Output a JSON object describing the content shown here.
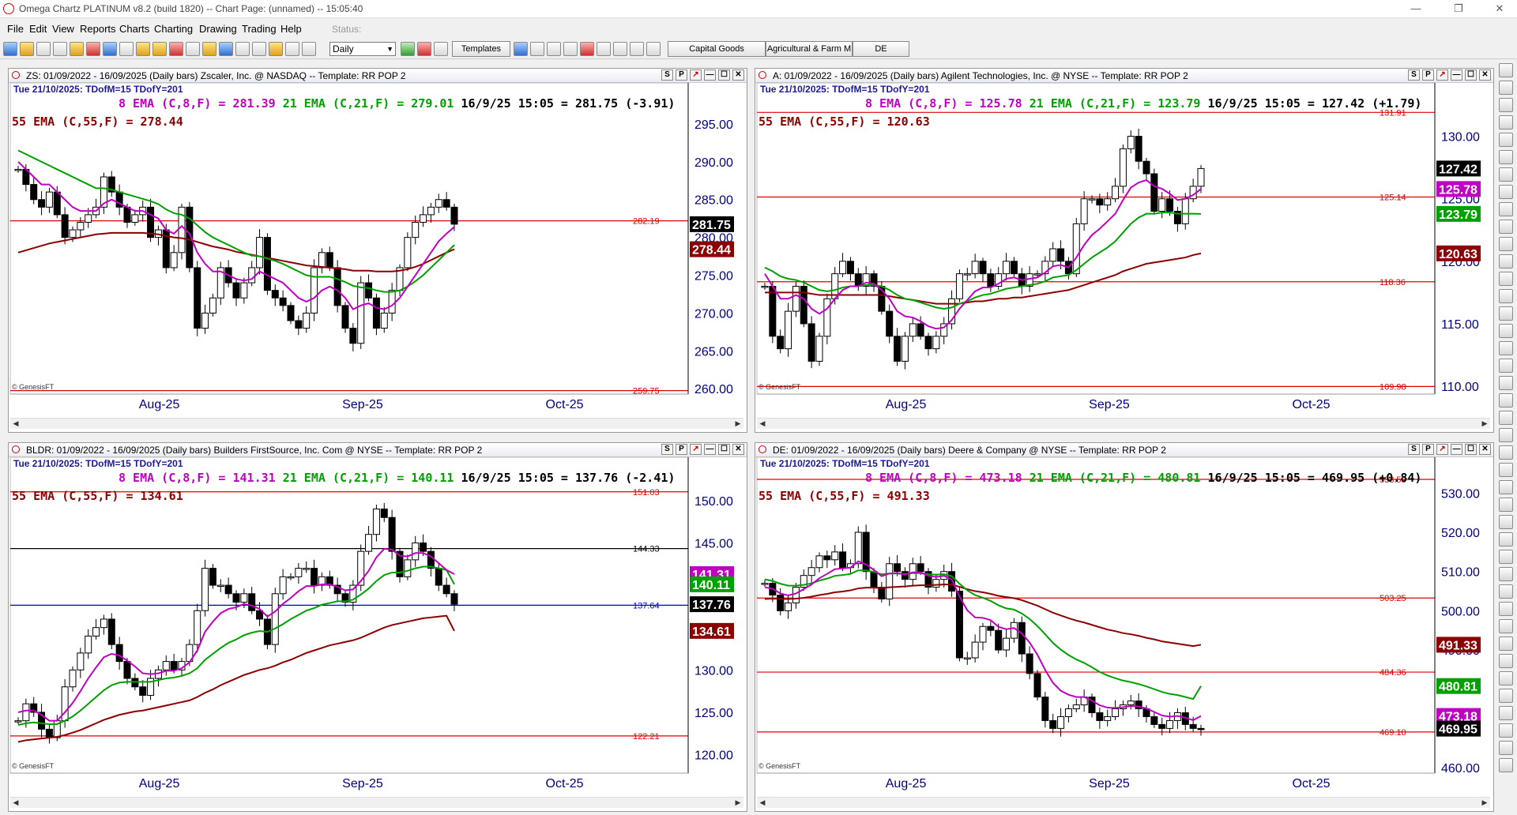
{
  "window": {
    "title": "Omega Chartz PLATINUM v8.2 (build 1820)  --  Chart Page: (unnamed) -- 15:05:40"
  },
  "menu": [
    "File",
    "Edit",
    "View",
    "Reports",
    "Charts",
    "Charting",
    "Drawing",
    "Trading",
    "Help"
  ],
  "status_label": "Status:",
  "toolbar": {
    "period_value": "Daily",
    "templates_label": "Templates",
    "pages": [
      "Capital Goods",
      "Agricultural & Farm M",
      "DE"
    ]
  },
  "colors": {
    "ema8": "#c000c0",
    "ema21": "#00a000",
    "ema55": "#8b0000",
    "hline": "#e00000",
    "price": "#000000"
  },
  "panels": [
    {
      "title": "ZS: 01/09/2022 - 16/09/2025  (Daily bars)  Zscaler, Inc. @ NASDAQ  --  Template: RR POP 2",
      "subheader": "Tue  21/10/2025:  TDofM=15  TDofY=201",
      "ema8": "8 EMA (C,8,F) = 281.39",
      "ema21": "21 EMA (C,21,F) = 279.01",
      "last": "16/9/25 15:05 = 281.75 (-3.91)",
      "ema55": "55 EMA (C,55,F) = 278.44",
      "copyright": "© GenesisFT"
    },
    {
      "title": "A: 01/09/2022 - 16/09/2025  (Daily bars)  Agilent Technologies, Inc. @ NYSE  --  Template: RR POP 2",
      "subheader": "Tue  21/10/2025:  TDofM=15  TDofY=201",
      "ema8": "8 EMA (C,8,F) = 125.78",
      "ema21": "21 EMA (C,21,F) = 123.79",
      "last": "16/9/25 15:05 = 127.42 (+1.79)",
      "ema55": "55 EMA (C,55,F) = 120.63",
      "copyright": "© GenesisFT"
    },
    {
      "title": "BLDR: 01/09/2022 - 16/09/2025  (Daily bars)  Builders FirstSource, Inc. Com @ NYSE  --  Template: RR POP 2",
      "subheader": "Tue  21/10/2025:  TDofM=15  TDofY=201",
      "ema8": "8 EMA (C,8,F) = 141.31",
      "ema21": "21 EMA (C,21,F) = 140.11",
      "last": "16/9/25 15:05 = 137.76 (-2.41)",
      "ema55": "55 EMA (C,55,F) = 134.61",
      "copyright": "© GenesisFT"
    },
    {
      "title": "DE: 01/09/2022 - 16/09/2025  (Daily bars)  Deere & Company @ NYSE  --  Template: RR POP 2",
      "subheader": "Tue  21/10/2025:  TDofM=15  TDofY=201",
      "ema8": "8 EMA (C,8,F) = 473.18",
      "ema21": "21 EMA (C,21,F) = 480.81",
      "last": "16/9/25 15:05 = 469.95 (+0.84)",
      "ema55": "55 EMA (C,55,F) = 491.33",
      "copyright": "© GenesisFT"
    }
  ],
  "chart_data": [
    {
      "type": "line",
      "symbol": "ZS",
      "x_tick_labels": [
        "Aug-25",
        "Sep-25",
        "Oct-25"
      ],
      "y_tick_labels": [
        "295.00",
        "290.00",
        "285.00",
        "280.00",
        "275.00",
        "270.00",
        "265.00",
        "260.00"
      ],
      "ylim": [
        259.5,
        297.5
      ],
      "price_labels": {
        "last": "281.75",
        "ema55": "278.44"
      },
      "hlines": [
        {
          "value": 282.19,
          "label": "282.19",
          "color": "#e00000"
        },
        {
          "value": 259.75,
          "label": "259.75",
          "color": "#e00000"
        }
      ],
      "close": [
        289,
        287,
        285,
        284,
        286,
        283,
        280,
        281,
        282,
        283,
        284,
        288,
        286,
        284,
        282,
        283,
        284,
        280,
        281,
        276,
        278,
        284,
        276,
        268,
        270,
        272,
        276,
        274,
        272,
        274,
        276,
        280,
        273,
        272,
        271,
        269,
        268,
        270,
        276,
        278,
        276,
        271,
        268,
        266,
        274,
        272,
        268,
        270,
        273,
        276,
        280,
        282,
        283,
        284,
        285,
        284,
        281.75
      ],
      "ema8": [
        290,
        289,
        288,
        287,
        287,
        286,
        285,
        284,
        283.5,
        283.5,
        283.5,
        284.5,
        285,
        284.5,
        284,
        283.5,
        283.5,
        283,
        282.5,
        281,
        280.5,
        281.5,
        280.5,
        278,
        276.5,
        275.5,
        275.5,
        275,
        274.5,
        274.3,
        274.5,
        275.5,
        275,
        274.5,
        274,
        273,
        272,
        271.5,
        272,
        273,
        273.5,
        273,
        272,
        270.5,
        271,
        271.3,
        270.7,
        270.5,
        271,
        272,
        273.5,
        275,
        276.5,
        278,
        279.5,
        280.5,
        281.39
      ],
      "ema21": [
        291.5,
        291,
        290.5,
        290,
        289.5,
        289,
        288.5,
        288,
        287.5,
        287,
        286.5,
        286.5,
        286.3,
        286,
        285.7,
        285.4,
        285.1,
        284.8,
        284.4,
        283.7,
        283.2,
        283,
        282.5,
        281.6,
        280.7,
        280,
        279.5,
        279,
        278.5,
        278,
        277.6,
        277.5,
        277.2,
        276.9,
        276.5,
        276,
        275.5,
        275,
        274.8,
        274.8,
        274.8,
        274.5,
        274.1,
        273.6,
        273.4,
        273.3,
        273,
        272.8,
        272.8,
        273,
        273.5,
        274.2,
        275,
        276,
        277,
        278,
        279.01
      ],
      "ema55": [
        278,
        278.3,
        278.6,
        278.9,
        279.2,
        279.4,
        279.6,
        279.8,
        280,
        280.2,
        280.4,
        280.5,
        280.6,
        280.6,
        280.6,
        280.6,
        280.6,
        280.5,
        280.4,
        280.2,
        280,
        279.9,
        279.7,
        279.4,
        279.1,
        278.8,
        278.6,
        278.4,
        278.1,
        277.9,
        277.7,
        277.5,
        277.3,
        277.1,
        276.9,
        276.7,
        276.5,
        276.3,
        276.2,
        276.1,
        276,
        275.9,
        275.8,
        275.6,
        275.6,
        275.6,
        275.5,
        275.5,
        275.5,
        275.6,
        275.8,
        276.1,
        276.5,
        277,
        277.5,
        278,
        278.44
      ]
    },
    {
      "type": "line",
      "symbol": "A",
      "x_tick_labels": [
        "Aug-25",
        "Sep-25",
        "Oct-25"
      ],
      "y_tick_labels": [
        "130.00",
        "125.00",
        "120.00",
        "115.00",
        "110.00"
      ],
      "ylim": [
        109.5,
        132.5
      ],
      "price_labels": {
        "last": "127.42",
        "ema8": "125.78",
        "ema21": "123.79",
        "ema55": "120.63"
      },
      "hlines": [
        {
          "value": 131.91,
          "label": "131.91",
          "color": "#e00000"
        },
        {
          "value": 125.14,
          "label": "125.14",
          "color": "#e00000"
        },
        {
          "value": 118.36,
          "label": "118.36",
          "color": "#e00000"
        },
        {
          "value": 109.98,
          "label": "109.98",
          "color": "#e00000"
        }
      ],
      "close": [
        118,
        114,
        113,
        116,
        118,
        115,
        112,
        114,
        117,
        119,
        120,
        119,
        118,
        119,
        118,
        116,
        114,
        112,
        114,
        115,
        114,
        113,
        114,
        115,
        117,
        119,
        119,
        120,
        119,
        118,
        119,
        120,
        119,
        118,
        119,
        119,
        120,
        121,
        120,
        119,
        123,
        125,
        125,
        124.5,
        125,
        126,
        129,
        130,
        128,
        127,
        124,
        125,
        124,
        123,
        125,
        126,
        127.42
      ],
      "ema8": [
        119,
        118,
        117,
        117,
        117.3,
        117,
        116.2,
        115.8,
        116.2,
        117,
        117.7,
        118,
        118,
        118.3,
        118.2,
        117.7,
        117,
        116,
        115.6,
        115.5,
        115.2,
        114.8,
        114.6,
        114.7,
        115.3,
        116.2,
        116.9,
        117.6,
        117.9,
        117.9,
        118.2,
        118.6,
        118.7,
        118.5,
        118.6,
        118.7,
        119.1,
        119.6,
        119.7,
        119.5,
        120.3,
        121.3,
        122.1,
        122.6,
        123.2,
        123.8,
        124.9,
        125.9,
        126.3,
        126.5,
        126,
        125.8,
        125.4,
        124.9,
        125,
        125.3,
        125.78
      ],
      "ema21": [
        119.5,
        119.2,
        118.8,
        118.6,
        118.5,
        118.3,
        118,
        117.7,
        117.6,
        117.7,
        117.9,
        118,
        118,
        118.1,
        118.1,
        118,
        117.7,
        117.3,
        117,
        116.9,
        116.7,
        116.5,
        116.3,
        116.2,
        116.3,
        116.6,
        116.8,
        117.1,
        117.3,
        117.4,
        117.6,
        117.8,
        117.9,
        118,
        118.1,
        118.2,
        118.4,
        118.7,
        118.8,
        118.9,
        119.3,
        119.8,
        120.3,
        120.7,
        121.1,
        121.6,
        122.3,
        123,
        123.5,
        123.8,
        123.8,
        123.9,
        123.9,
        123.8,
        123.8,
        123.8,
        123.79
      ],
      "ema55": [
        117.5,
        117.5,
        117.5,
        117.5,
        117.5,
        117.5,
        117.4,
        117.3,
        117.3,
        117.3,
        117.3,
        117.3,
        117.3,
        117.3,
        117.3,
        117.3,
        117.2,
        117.1,
        117,
        116.9,
        116.8,
        116.7,
        116.6,
        116.6,
        116.6,
        116.6,
        116.7,
        116.8,
        116.8,
        116.9,
        117,
        117,
        117.1,
        117.1,
        117.2,
        117.3,
        117.4,
        117.5,
        117.6,
        117.7,
        117.9,
        118.1,
        118.3,
        118.5,
        118.7,
        118.9,
        119.2,
        119.4,
        119.6,
        119.8,
        119.9,
        120,
        120.1,
        120.2,
        120.3,
        120.5,
        120.63
      ]
    },
    {
      "type": "line",
      "symbol": "BLDR",
      "x_tick_labels": [
        "Aug-25",
        "Sep-25",
        "Oct-25"
      ],
      "y_tick_labels": [
        "150.00",
        "145.00",
        "140.00",
        "135.00",
        "130.00",
        "125.00",
        "120.00"
      ],
      "ylim": [
        118,
        152.5
      ],
      "price_labels": {
        "ema8": "141.31",
        "ema21": "140.11",
        "last": "137.76",
        "ema55": "134.61"
      },
      "hlines": [
        {
          "value": 151.03,
          "label": "151.03",
          "color": "#e00000"
        },
        {
          "value": 144.33,
          "label": "144.33",
          "color": "#000000"
        },
        {
          "value": 137.64,
          "label": "137.64",
          "color": "#0000cc"
        },
        {
          "value": 122.21,
          "label": "122.21",
          "color": "#e00000"
        }
      ],
      "close": [
        124,
        126,
        125,
        123,
        122,
        124,
        128,
        130,
        132,
        134,
        135,
        136,
        133,
        131,
        129,
        128,
        127,
        129,
        130,
        131,
        130,
        131,
        133,
        137,
        142,
        140,
        140,
        139,
        138,
        139,
        137,
        136,
        133,
        139,
        141,
        141,
        142,
        142,
        140,
        141,
        140,
        139,
        138,
        140,
        144,
        146,
        149,
        148,
        144,
        141,
        143,
        145,
        144,
        142,
        140,
        139,
        137.76
      ],
      "ema8": [
        125,
        125.2,
        125.2,
        124.7,
        124,
        124,
        125,
        126.1,
        127.5,
        129,
        130.3,
        131.5,
        131.9,
        131.7,
        131.1,
        130.4,
        129.6,
        129.5,
        129.6,
        129.9,
        129.9,
        130.2,
        130.9,
        132.3,
        134.5,
        135.7,
        136.7,
        137.2,
        137.4,
        137.8,
        137.6,
        137.2,
        136.3,
        136.9,
        137.8,
        138.5,
        139.3,
        139.9,
        139.9,
        140.1,
        140.1,
        139.8,
        139.4,
        139.5,
        140.5,
        141.7,
        143.3,
        144.3,
        144.2,
        143.5,
        143.4,
        143.8,
        143.8,
        143.4,
        142.6,
        141.8,
        141.31
      ],
      "ema21": [
        123.5,
        123.7,
        123.8,
        123.7,
        123.6,
        123.6,
        124,
        124.5,
        125.2,
        126,
        126.8,
        127.6,
        128.2,
        128.5,
        128.6,
        128.6,
        128.6,
        128.6,
        128.8,
        129,
        129.1,
        129.3,
        129.6,
        130.2,
        131.2,
        131.9,
        132.6,
        133.2,
        133.6,
        134.1,
        134.4,
        134.6,
        134.5,
        134.9,
        135.4,
        136,
        136.5,
        137,
        137.3,
        137.7,
        137.9,
        138.1,
        138.1,
        138.3,
        138.9,
        139.6,
        140.5,
        141.2,
        141.5,
        141.5,
        141.7,
        142,
        142.2,
        142.2,
        142,
        141.8,
        140.11
      ],
      "ema55": [
        121.5,
        121.7,
        121.8,
        121.9,
        122,
        122.1,
        122.3,
        122.6,
        122.9,
        123.3,
        123.7,
        124.1,
        124.4,
        124.7,
        124.9,
        125.1,
        125.2,
        125.4,
        125.6,
        125.8,
        126,
        126.2,
        126.4,
        126.8,
        127.3,
        127.7,
        128.2,
        128.6,
        129,
        129.4,
        129.7,
        130,
        130.2,
        130.5,
        130.9,
        131.2,
        131.6,
        132,
        132.3,
        132.6,
        132.9,
        133.1,
        133.3,
        133.5,
        133.8,
        134.2,
        134.6,
        135,
        135.3,
        135.5,
        135.7,
        135.9,
        136.1,
        136.2,
        136.3,
        136.4,
        134.61
      ]
    },
    {
      "type": "line",
      "symbol": "DE",
      "x_tick_labels": [
        "Aug-25",
        "Sep-25",
        "Oct-25"
      ],
      "y_tick_labels": [
        "530.00",
        "520.00",
        "510.00",
        "500.00",
        "490.00",
        "480.00",
        "470.00",
        "460.00"
      ],
      "ylim": [
        459,
        533.5
      ],
      "price_labels": {
        "ema55": "491.33",
        "ema21": "480.81",
        "ema8": "473.18",
        "last": "469.95"
      },
      "hlines": [
        {
          "value": 533.5,
          "label": "533.53",
          "color": "#e00000"
        },
        {
          "value": 503.25,
          "label": "503.25",
          "color": "#e00000"
        },
        {
          "value": 484.36,
          "label": "484.36",
          "color": "#e00000"
        },
        {
          "value": 469.1,
          "label": "469.10",
          "color": "#e00000"
        }
      ],
      "close": [
        507,
        504,
        500,
        502,
        506,
        509,
        511,
        514,
        513,
        515,
        511,
        512,
        520,
        510,
        506,
        503,
        512,
        510,
        508,
        512,
        510,
        506,
        508,
        510,
        505,
        488,
        488,
        492,
        496,
        495,
        490,
        493,
        497,
        489,
        484,
        478,
        472,
        470,
        473,
        475,
        476,
        478,
        474,
        472,
        473,
        475,
        476,
        477,
        475,
        473,
        471,
        470,
        472,
        474,
        471,
        470,
        469.95
      ],
      "ema8": [
        506,
        505.6,
        504.4,
        503.9,
        504.4,
        505.5,
        506.7,
        508.3,
        509.4,
        510.6,
        510.8,
        511,
        512.6,
        511.8,
        510.4,
        508.8,
        509.5,
        509.6,
        509.2,
        509.8,
        509.8,
        508.9,
        508.6,
        508.9,
        508,
        503.6,
        500.1,
        498.3,
        498.2,
        497.6,
        495.9,
        495.3,
        495.6,
        494.2,
        491.9,
        488.8,
        484.9,
        481.6,
        479.6,
        478.6,
        478,
        478,
        477.1,
        475.9,
        475.3,
        475.2,
        475.4,
        475.7,
        475.6,
        475.1,
        474.2,
        473.3,
        473,
        473.2,
        472.7,
        472.1,
        473.18
      ],
      "ema21": [
        508,
        507.6,
        506.9,
        506.4,
        506.4,
        506.6,
        507,
        507.7,
        508.2,
        508.9,
        509.1,
        509.4,
        510.3,
        510.3,
        509.9,
        509.3,
        509.5,
        509.5,
        509.4,
        509.6,
        509.6,
        509.3,
        509.2,
        509.3,
        508.8,
        506.9,
        505.2,
        504,
        503.3,
        502.5,
        501.4,
        500.6,
        500.3,
        499.3,
        497.9,
        496.1,
        494,
        491.8,
        490.1,
        488.7,
        487.6,
        486.7,
        485.6,
        484.4,
        483.5,
        482.8,
        482.2,
        481.8,
        481.3,
        480.7,
        480,
        479.3,
        478.8,
        478.5,
        478,
        477.5,
        480.81
      ],
      "ema55": [
        503,
        503.1,
        503,
        503,
        503.1,
        503.3,
        503.6,
        504,
        504.3,
        504.7,
        504.9,
        505.2,
        505.7,
        505.9,
        505.9,
        505.8,
        506,
        506.1,
        506.2,
        506.4,
        506.5,
        506.5,
        506.6,
        506.7,
        506.7,
        506.1,
        505.5,
        505,
        504.7,
        504.3,
        503.8,
        503.5,
        503.2,
        502.7,
        502,
        501.3,
        500.4,
        499.5,
        498.8,
        498.1,
        497.5,
        497,
        496.4,
        495.8,
        495.2,
        494.8,
        494.3,
        494,
        493.6,
        493.1,
        492.7,
        492.2,
        491.9,
        491.6,
        491.3,
        491,
        491.33
      ]
    }
  ]
}
